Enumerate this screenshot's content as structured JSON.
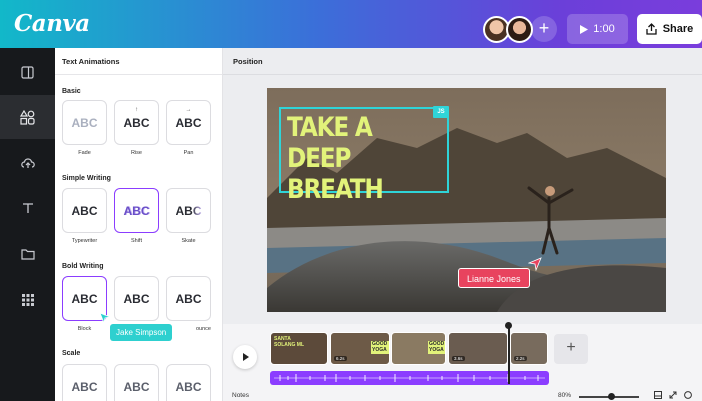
{
  "header": {
    "logo": "Canva",
    "add_label": "+",
    "play_time": "1:00",
    "share_label": "Share",
    "gradient_start": "#12b8c9",
    "gradient_end": "#7a3ddc"
  },
  "rail": {
    "items": [
      "layout-icon",
      "elements-icon",
      "upload-icon",
      "text-icon",
      "folder-icon",
      "apps-icon"
    ],
    "active": "elements-icon"
  },
  "panel": {
    "title": "Text Animations",
    "sections": {
      "basic": "Basic",
      "simple_writing": "Simple Writing",
      "bold_writing": "Bold Writing",
      "scale": "Scale"
    },
    "sample": "ABC",
    "basic_items": [
      "Fade",
      "Rise",
      "Pan"
    ],
    "simple_items": [
      "Typewriter",
      "Shift",
      "Skate"
    ],
    "bold_items": [
      "Block",
      "",
      "ounce"
    ],
    "accent": "#8b3dff"
  },
  "cursors": {
    "panel_user": "Jake Simpson",
    "panel_color": "#2ed0cf",
    "canvas_user": "Lianne Jones",
    "canvas_color": "#e8435e"
  },
  "workspace": {
    "position_label": "Position",
    "headline": "TAKE A DEEP BREATH",
    "selection_tag": "JS",
    "headline_color": "#e2f37a",
    "selection_color": "#2fd4d8"
  },
  "timeline": {
    "clips": [
      {
        "text": "SANTA SOLANG ML"
      },
      {
        "duration": "6.2s",
        "text": "GOOD YOGA"
      },
      {
        "text": "GOOD YOGA"
      },
      {
        "duration": "3.6s"
      },
      {
        "duration": "2.2s"
      }
    ],
    "add_label": "+",
    "audio_color": "#8b3dff"
  },
  "status": {
    "notes": "Notes",
    "zoom": "80%"
  }
}
